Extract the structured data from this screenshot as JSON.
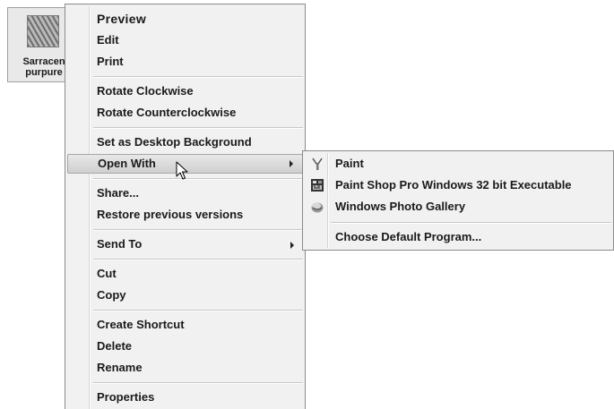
{
  "desktop": {
    "file_label_line1": "Sarracen",
    "file_label_line2": "purpure"
  },
  "context_menu": {
    "preview": "Preview",
    "edit": "Edit",
    "print": "Print",
    "rotate_cw": "Rotate Clockwise",
    "rotate_ccw": "Rotate Counterclockwise",
    "set_background": "Set as Desktop Background",
    "open_with": "Open With",
    "share": "Share...",
    "restore": "Restore previous versions",
    "send_to": "Send To",
    "cut": "Cut",
    "copy": "Copy",
    "create_shortcut": "Create Shortcut",
    "delete": "Delete",
    "rename": "Rename",
    "properties": "Properties"
  },
  "open_with_submenu": {
    "paint": "Paint",
    "psp": "Paint Shop Pro Windows 32 bit Executable",
    "photo_gallery": "Windows Photo Gallery",
    "choose_default": "Choose Default Program..."
  },
  "icons": {
    "paint": "paint-brush-icon",
    "psp": "psp-app-icon",
    "photo_gallery": "photo-gallery-icon",
    "submenu_arrow": "chevron-right-icon",
    "cursor": "mouse-pointer-icon"
  },
  "colors": {
    "menu_bg": "#f1f1f1",
    "menu_border": "#8a8a8a",
    "hover_bg": "#d8d8d8"
  }
}
